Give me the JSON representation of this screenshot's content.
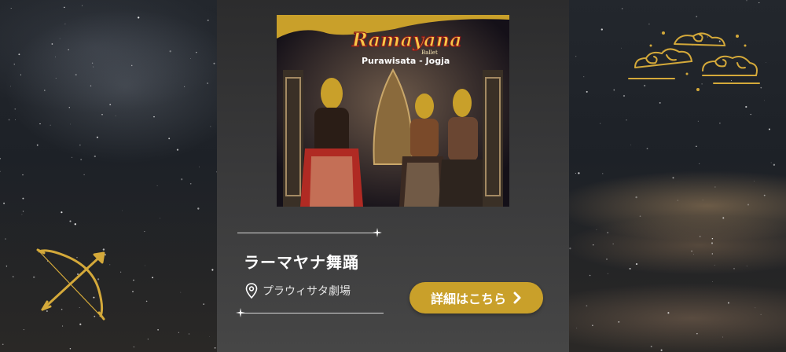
{
  "card": {
    "title": "ラーマヤナ舞踊",
    "venue": "プラウィサタ劇場",
    "cta_label": "詳細はこちら"
  },
  "photo": {
    "logo_title": "Ramayana",
    "logo_sub": "Ballet",
    "logo_place": "Purawisata - Jogja"
  },
  "colors": {
    "accent_gold": "#c9a02a",
    "card_dark": "#2c2c2d"
  },
  "icons": {
    "location": "location-pin-icon",
    "chevron": "chevron-right-icon",
    "bow": "bow-arrow-icon",
    "cloud": "cloud-ornament-icon"
  }
}
